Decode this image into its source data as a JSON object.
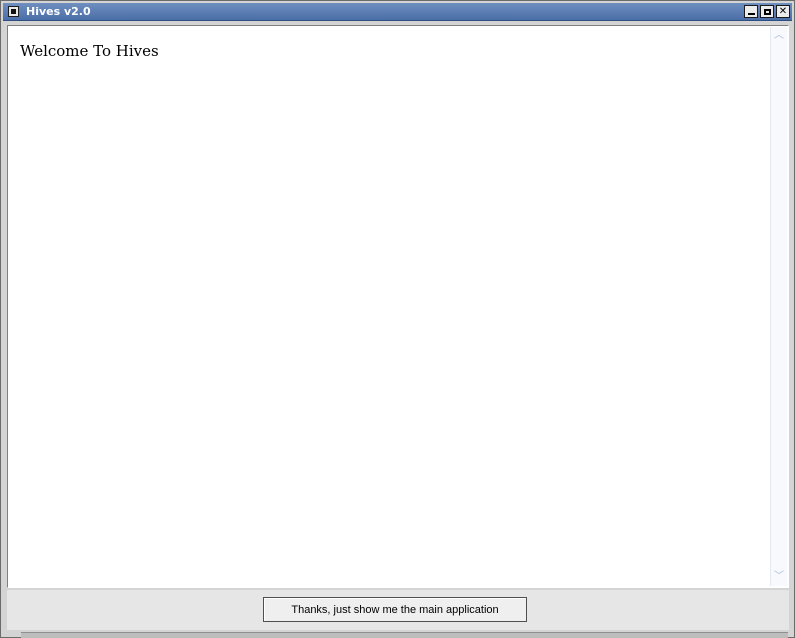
{
  "window": {
    "title": "Hives v2.0",
    "buttons": {
      "minimize_icon": "minimize-icon",
      "maximize_icon": "maximize-icon",
      "close_icon": "close-icon",
      "close_glyph": "✕"
    }
  },
  "content": {
    "heading": "Welcome To Hives"
  },
  "scrollbar": {
    "up_glyph": "︿",
    "down_glyph": "﹀"
  },
  "footer": {
    "continue_label": "Thanks, just show me the main application"
  },
  "colors": {
    "titlebar_start": "#6f8fbf",
    "titlebar_end": "#4a6ea8"
  }
}
